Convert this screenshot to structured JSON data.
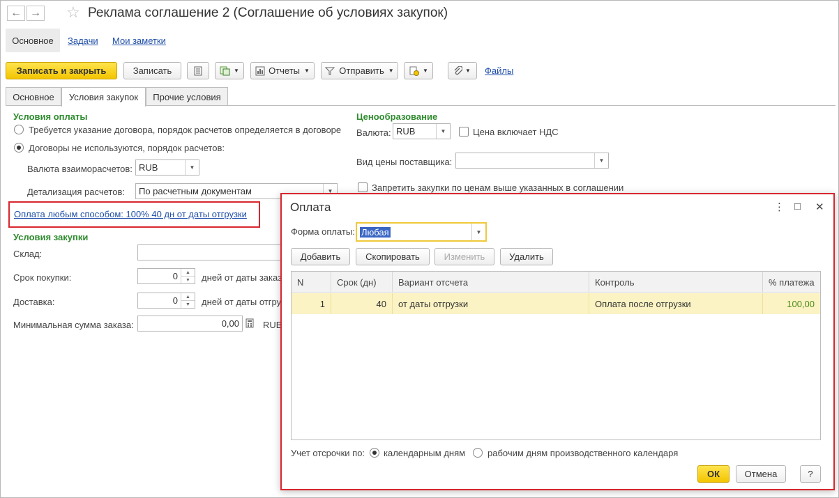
{
  "window": {
    "title": "Реклама соглашение 2 (Соглашение об условиях закупок)",
    "back_glyph": "←",
    "forward_glyph": "→",
    "star_glyph": "☆"
  },
  "topnav": {
    "items": [
      "Основное",
      "Задачи",
      "Мои заметки"
    ]
  },
  "toolbar": {
    "save_close": "Записать и закрыть",
    "save": "Записать",
    "reports": "Отчеты",
    "send": "Отправить",
    "files": "Файлы",
    "icons": [
      "list-icon",
      "generate-icon",
      "print-icon",
      "clip-icon"
    ]
  },
  "tabs": [
    "Основное",
    "Условия закупок",
    "Прочие условия"
  ],
  "payment_terms": {
    "title": "Условия оплаты",
    "radio1": "Требуется указание договора, порядок расчетов определяется в договоре",
    "radio2": "Договоры не используются, порядок расчетов:",
    "currency_label": "Валюта взаиморасчетов:",
    "currency_value": "RUB",
    "detail_label": "Детализация расчетов:",
    "detail_value": "По расчетным документам",
    "payment_link": "Оплата любым способом: 100% 40 дн от даты отгрузки"
  },
  "purchase_terms": {
    "title": "Условия закупки",
    "warehouse_label": "Склад:",
    "term_label": "Срок покупки:",
    "term_value": "0",
    "term_suffix": "дней от даты заказ",
    "delivery_label": "Доставка:",
    "delivery_value": "0",
    "delivery_suffix": "дней от даты отгру",
    "min_sum_label": "Минимальная сумма заказа:",
    "min_sum_value": "0,00",
    "min_sum_currency": "RUB"
  },
  "pricing": {
    "title": "Ценообразование",
    "currency_label": "Валюта:",
    "currency_value": "RUB",
    "vat_label": "Цена включает НДС",
    "supplier_price_label": "Вид цены поставщика:",
    "forbid_label": "Запретить закупки по ценам выше указанных в соглашении"
  },
  "dialog": {
    "title": "Оплата",
    "form_label": "Форма оплаты:",
    "form_value": "Любая",
    "buttons": {
      "add": "Добавить",
      "copy": "Скопировать",
      "edit": "Изменить",
      "delete": "Удалить"
    },
    "columns": [
      "N",
      "Срок (дн)",
      "Вариант отсчета",
      "Контроль",
      "% платежа"
    ],
    "rows": [
      {
        "n": "1",
        "days": "40",
        "variant": "от даты отгрузки",
        "control": "Оплата после отгрузки",
        "percent": "100,00"
      }
    ],
    "deferral_label": "Учет отсрочки по:",
    "deferral_option1": "календарным дням",
    "deferral_option2": "рабочим дням производственного календаря",
    "ok": "ОК",
    "cancel": "Отмена",
    "help": "?",
    "menu_glyph": "⋮",
    "maximize_glyph": "□",
    "close_glyph": "✕"
  },
  "colors": {
    "accent_yellow": "#f3c500",
    "section_green": "#2e8b2e",
    "link_blue": "#1f4ea8",
    "highlight_red": "#d9262e",
    "row_selected": "#fbf3c3",
    "percent_green": "#4d8a1a"
  }
}
